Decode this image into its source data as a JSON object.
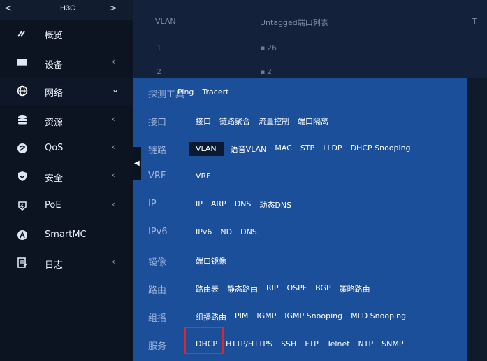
{
  "sidebar": {
    "brand": "H3C",
    "back_arrow": "<",
    "forward_arrow": ">",
    "items": [
      {
        "label": "概览",
        "icon": "speedometer-icon"
      },
      {
        "label": "设备",
        "icon": "device-icon"
      },
      {
        "label": "网络",
        "icon": "globe-icon"
      },
      {
        "label": "资源",
        "icon": "database-icon"
      },
      {
        "label": "QoS",
        "icon": "qos-icon"
      },
      {
        "label": "安全",
        "icon": "shield-icon"
      },
      {
        "label": "PoE",
        "icon": "poe-icon"
      },
      {
        "label": "SmartMC",
        "icon": "smartmc-icon"
      },
      {
        "label": "日志",
        "icon": "log-icon"
      }
    ]
  },
  "table": {
    "headers": [
      "VLAN",
      "Untagged端口列表",
      "T"
    ],
    "rows": [
      {
        "vlan": "1",
        "untagged": "26"
      },
      {
        "vlan": "2",
        "untagged": "2"
      }
    ]
  },
  "menu": {
    "rows": [
      {
        "category": "探测工具",
        "items": [
          "Ping",
          "Tracert"
        ]
      },
      {
        "category": "接口",
        "items": [
          "接口",
          "链路聚合",
          "流量控制",
          "端口隔离"
        ]
      },
      {
        "category": "链路",
        "items": [
          "VLAN",
          "语音VLAN",
          "MAC",
          "STP",
          "LLDP",
          "DHCP Snooping"
        ],
        "selected": "VLAN"
      },
      {
        "category": "VRF",
        "items": [
          "VRF"
        ]
      },
      {
        "category": "IP",
        "items": [
          "IP",
          "ARP",
          "DNS",
          "动态DNS"
        ]
      },
      {
        "category": "IPv6",
        "items": [
          "IPv6",
          "ND",
          "DNS"
        ]
      },
      {
        "category": "镜像",
        "items": [
          "端口镜像"
        ]
      },
      {
        "category": "路由",
        "items": [
          "路由表",
          "静态路由",
          "RIP",
          "OSPF",
          "BGP",
          "策略路由"
        ]
      },
      {
        "category": "组播",
        "items": [
          "组播路由",
          "PIM",
          "IGMP",
          "IGMP Snooping",
          "MLD Snooping"
        ]
      },
      {
        "category": "服务",
        "items": [
          "DHCP",
          "HTTP/HTTPS",
          "SSH",
          "FTP",
          "Telnet",
          "NTP",
          "SNMP"
        ],
        "highlighted": "DHCP"
      }
    ]
  },
  "colors": {
    "panel": "#1c4f9a",
    "sidebar": "#0c1421",
    "highlight_border": "#e0262d"
  }
}
